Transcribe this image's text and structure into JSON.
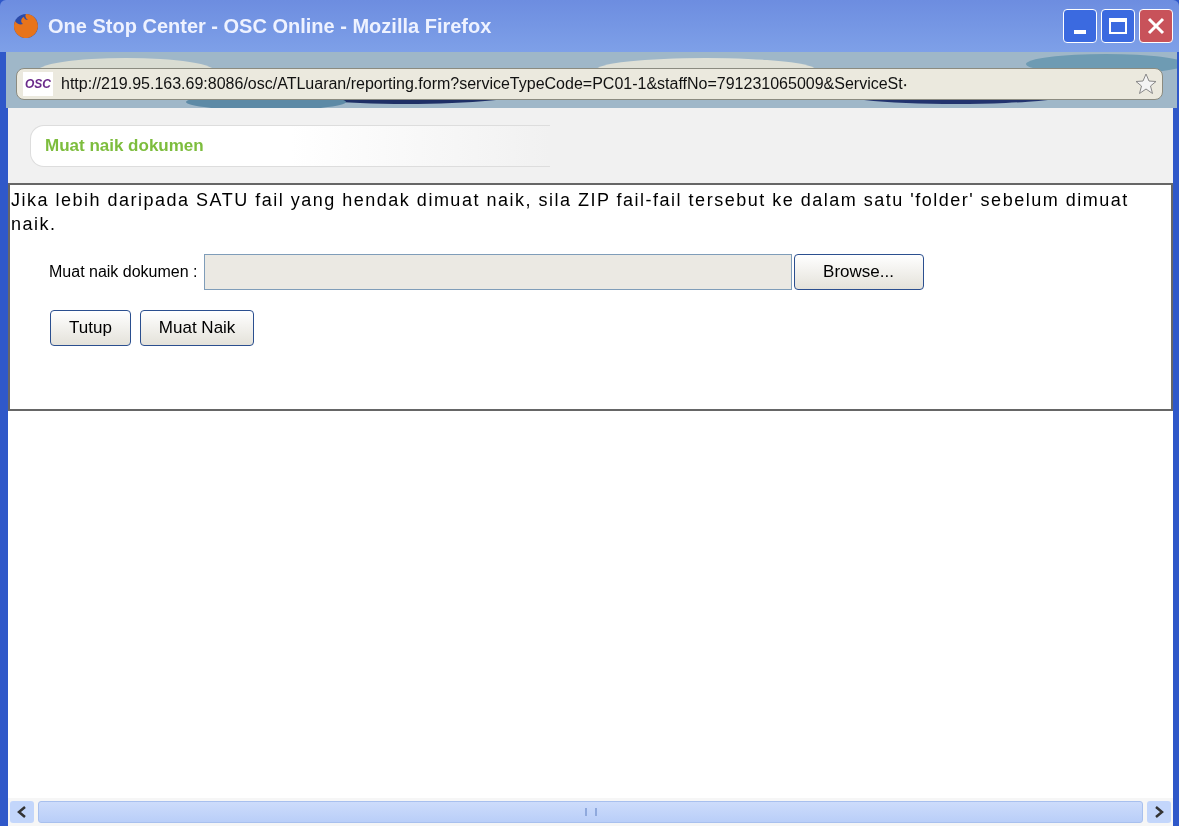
{
  "window": {
    "title": "One Stop Center - OSC Online - Mozilla Firefox",
    "url": "http://219.95.163.69:8086/osc/ATLuaran/reporting.form?serviceTypeCode=PC01-1&staffNo=791231065009&ServiceSt‧",
    "site_icon_text": "OSC"
  },
  "panel": {
    "heading": "Muat naik dokumen"
  },
  "notice": "Jika lebih daripada SATU fail yang hendak dimuat naik, sila ZIP fail-fail tersebut ke dalam satu 'folder' sebelum dimuat naik.",
  "upload": {
    "label": "Muat naik dokumen :",
    "browse": "Browse..."
  },
  "buttons": [
    "Tutup",
    "Muat Naik"
  ]
}
